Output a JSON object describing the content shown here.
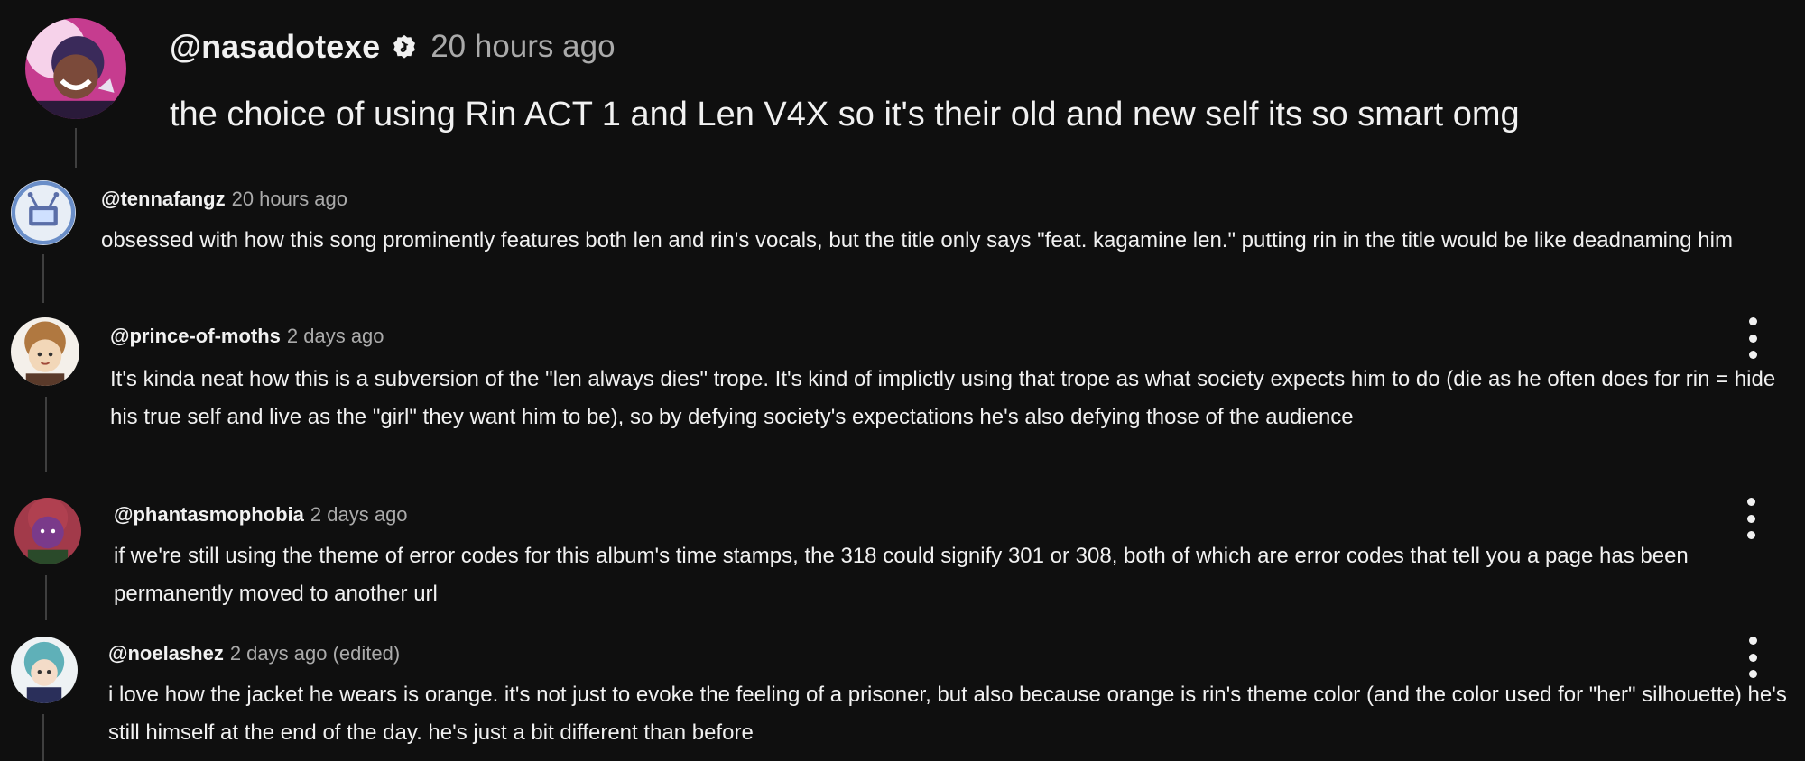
{
  "colors": {
    "background": "#0f0f0f",
    "text": "#f1f1f1",
    "muted": "#aaaaaa",
    "thread_line": "#3f3f3f"
  },
  "comments": [
    {
      "author": "@nasadotexe",
      "verified_icon": "verified-badge-icon",
      "time": "20 hours ago",
      "text": "the choice of using Rin ACT 1 and Len V4X so it's their old and new self its so smart omg"
    },
    {
      "author": "@tennafangz",
      "time": "20 hours ago",
      "text": "obsessed with how this song prominently features both len and rin's vocals, but the title only says \"feat. kagamine len.\" putting rin in the title would be like deadnaming him"
    },
    {
      "author": "@prince-of-moths",
      "time": "2 days ago",
      "menu_icon": "more-vert-icon",
      "text": "It's kinda neat how this is a subversion of the \"len always dies\" trope. It's kind of implictly using that trope as what society expects him to do (die as he often does for rin = hide his true self and live as the \"girl\" they want him to be), so by defying society's expectations he's also defying those of the audience"
    },
    {
      "author": "@phantasmophobia",
      "time": "2 days ago",
      "menu_icon": "more-vert-icon",
      "text": "if we're still using the theme of error codes for this album's time stamps, the 318 could signify 301 or 308, both of which are error codes that tell you a page has been permanently moved to another url"
    },
    {
      "author": "@noelashez",
      "time": "2 days ago (edited)",
      "menu_icon": "more-vert-icon",
      "text": "i love how the jacket he wears is orange. it's not just to evoke the feeling of a prisoner, but also because orange is rin's theme color (and the color used for \"her\" silhouette) he's still himself at the end of the day. he's just a bit different than before"
    }
  ]
}
